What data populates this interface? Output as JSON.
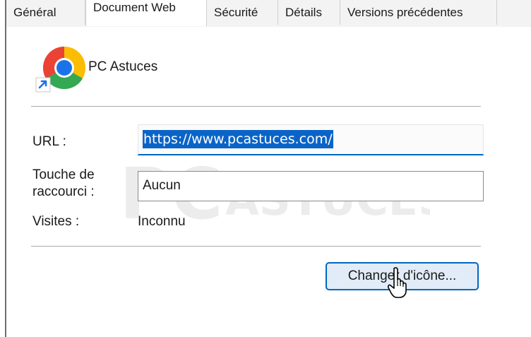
{
  "tabs": [
    {
      "label": "Général",
      "active": false
    },
    {
      "label": "Document Web",
      "active": true
    },
    {
      "label": "Sécurité",
      "active": false
    },
    {
      "label": "Détails",
      "active": false
    },
    {
      "label": "Versions précédentes",
      "active": false
    }
  ],
  "shortcut": {
    "name": "PC Astuces",
    "icon": "chrome-shortcut-icon"
  },
  "fields": {
    "url_label": "URL :",
    "url_value": "https://www.pcastuces.com/",
    "hotkey_label_line1": "Touche de",
    "hotkey_label_line2": "raccourci :",
    "hotkey_value": "Aucun",
    "visits_label": "Visites :",
    "visits_value": "Inconnu"
  },
  "buttons": {
    "change_icon": "Changer d'icône..."
  },
  "watermark": {
    "line1": "PC",
    "line2": "ASTUCES"
  },
  "colors": {
    "accent": "#0067c0",
    "selection": "#0a64c8",
    "button_bg": "#e1ecf8"
  }
}
